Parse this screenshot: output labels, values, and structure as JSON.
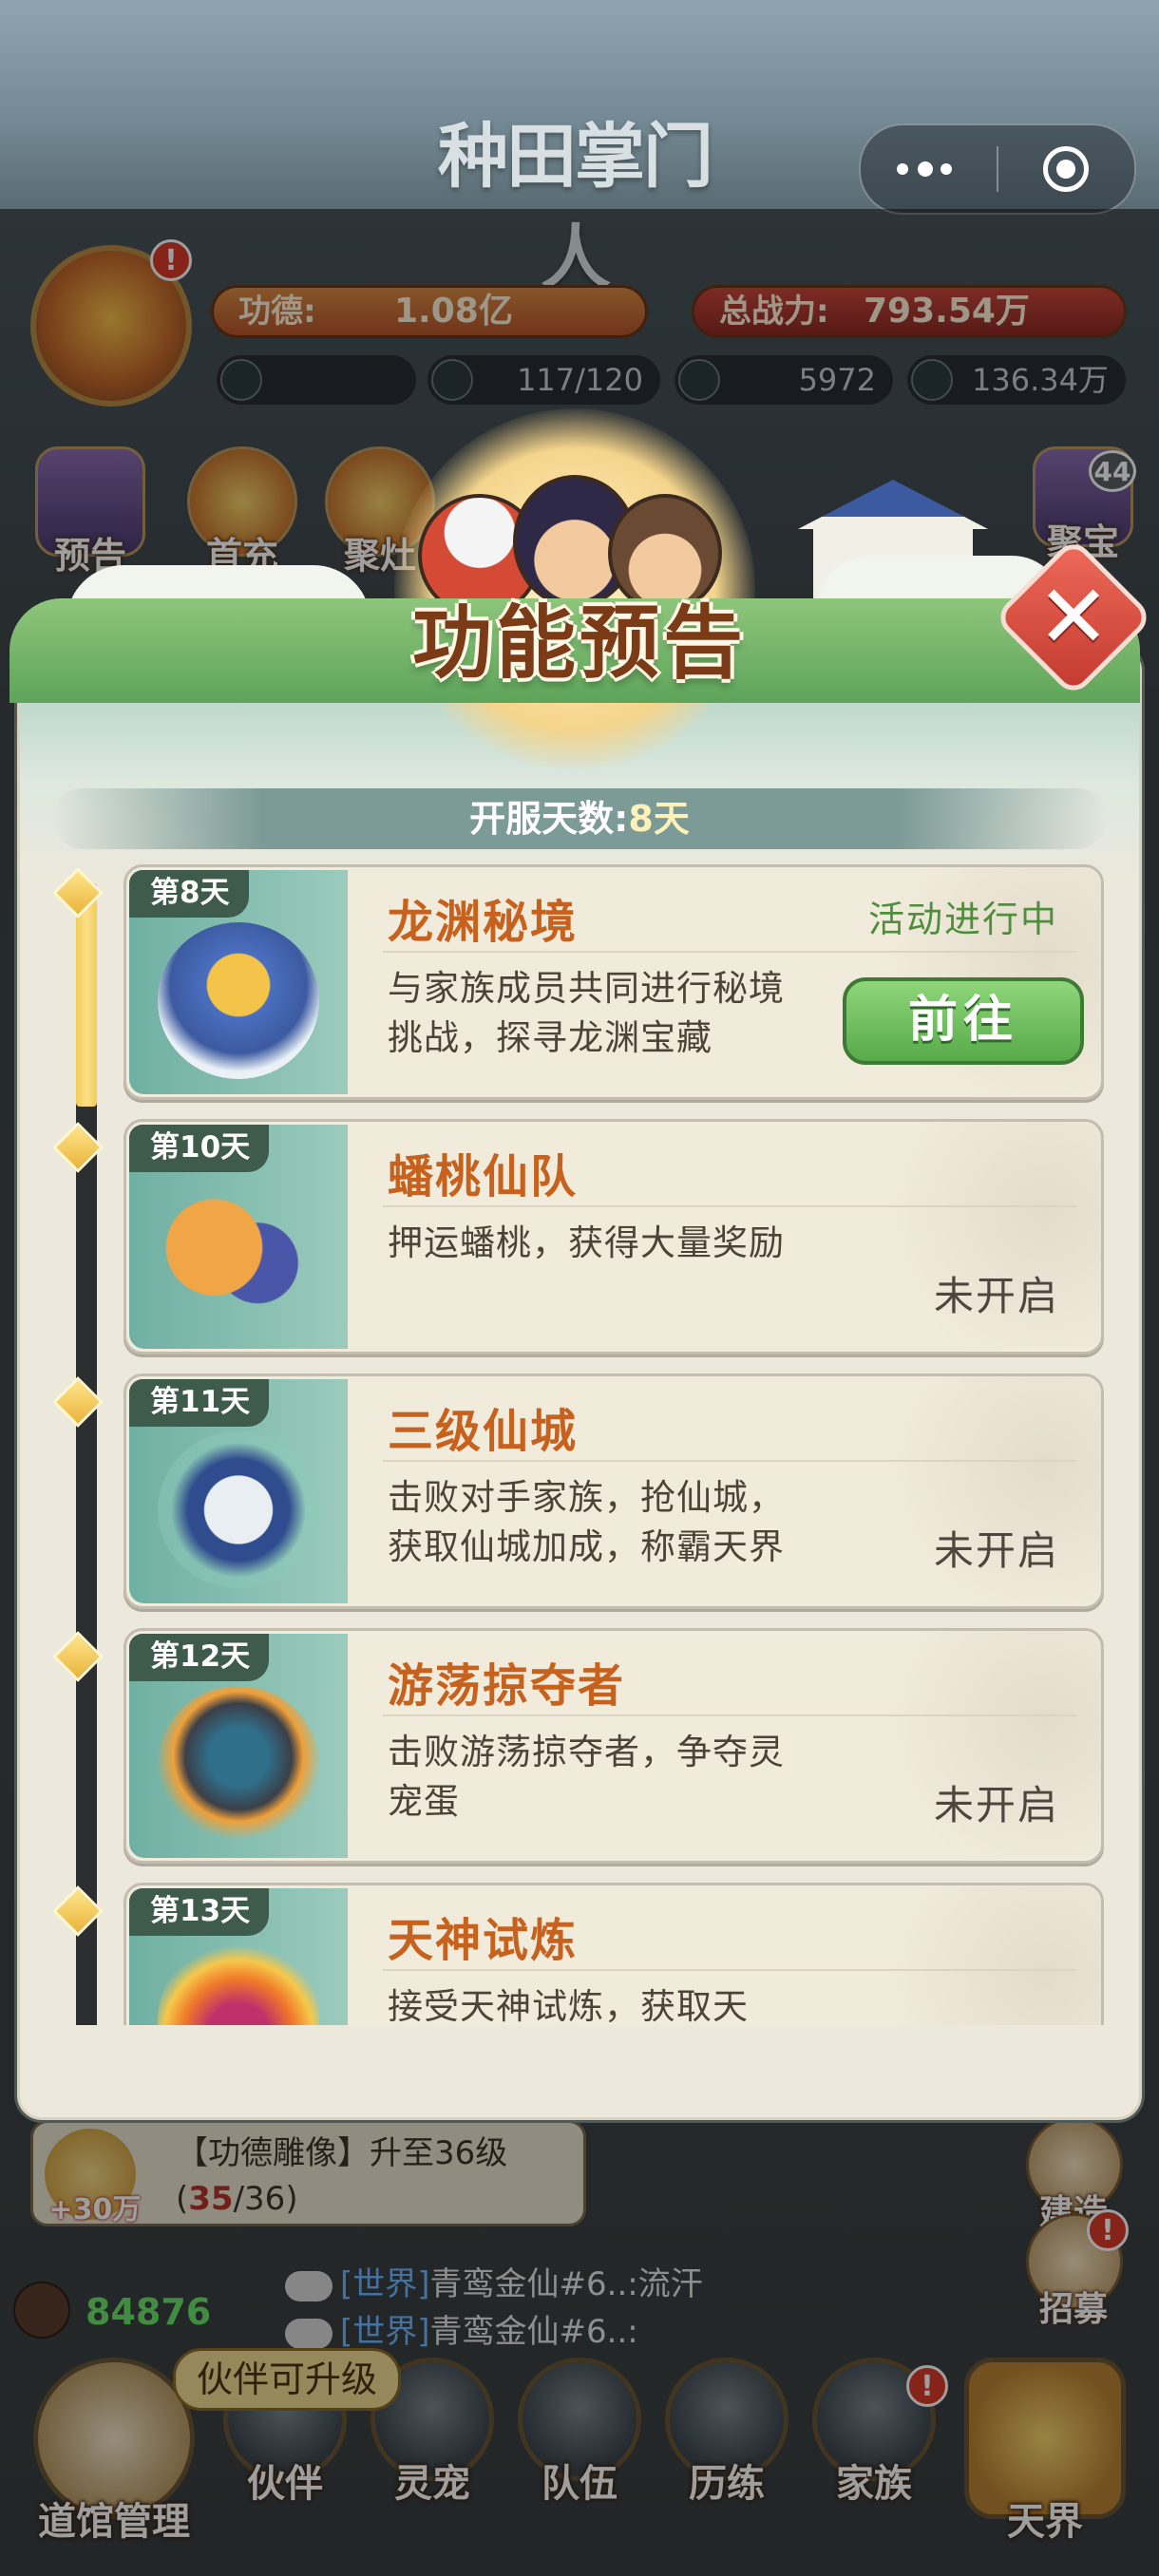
{
  "app": {
    "title": "种田掌门人"
  },
  "capsule": {
    "more_icon": "more-icon",
    "close_icon": "target-icon"
  },
  "hud": {
    "merit_label": "功德:",
    "merit_value": "1.08亿",
    "power_label": "总战力:",
    "power_value": "793.54万",
    "avatar_badge": "!",
    "resources": [
      {
        "icon": "arrow-up-icon",
        "value": ""
      },
      {
        "icon": "stamina-icon",
        "value": "117/120"
      },
      {
        "icon": "jade-icon",
        "value": "5972"
      },
      {
        "icon": "coin-icon",
        "value": "136.34万"
      }
    ],
    "left_buttons": [
      "预告",
      "首充",
      "聚灶"
    ],
    "treasure_label": "聚宝",
    "treasure_badge": "44"
  },
  "modal": {
    "title": "功能预告",
    "server_days_label": "开服天数:",
    "server_days_value": "8天",
    "items": [
      {
        "day": "第8天",
        "name": "龙渊秘境",
        "desc": "与家族成员共同进行秘境挑战，探寻龙渊宝藏",
        "status": "活动进行中",
        "action": "前往"
      },
      {
        "day": "第10天",
        "name": "蟠桃仙队",
        "desc": "押运蟠桃，获得大量奖励",
        "status": "未开启"
      },
      {
        "day": "第11天",
        "name": "三级仙城",
        "desc": "击败对手家族，抢仙城，获取仙城加成，称霸天界",
        "status": "未开启"
      },
      {
        "day": "第12天",
        "name": "游荡掠夺者",
        "desc": "击败游荡掠夺者，争夺灵宠蛋",
        "status": "未开启"
      },
      {
        "day": "第13天",
        "name": "天神试炼",
        "desc": "接受天神试炼，获取天",
        "status": ""
      }
    ]
  },
  "task": {
    "reward": "+30万",
    "text_prefix": "【功德雕像】升至36级(",
    "progress": "35",
    "text_suffix": "/36)"
  },
  "side_buttons": {
    "build": "建造",
    "recruit": "招募",
    "recruit_badge": "!"
  },
  "chat": [
    {
      "channel": "[世界]",
      "text": "青鸾金仙#6..:流汗"
    },
    {
      "channel": "[世界]",
      "text": "青鸾金仙#6..:"
    }
  ],
  "player_power": "84876",
  "tip": "伙伴可升级",
  "nav": {
    "hall": "道馆管理",
    "partner": "伙伴",
    "pet": "灵宠",
    "team": "队伍",
    "training": "历练",
    "clan": "家族",
    "heaven": "天界",
    "clan_badge": "!"
  },
  "colors": {
    "accent_green": "#57aa4a",
    "title_brown": "#7a3b16",
    "name_orange": "#c6621e",
    "close_red": "#c33a2e"
  }
}
